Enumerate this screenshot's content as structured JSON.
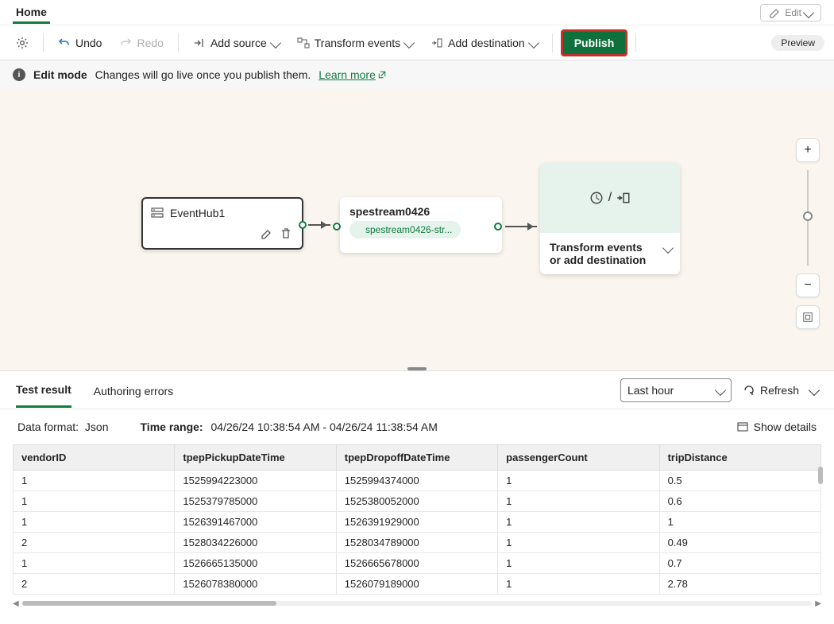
{
  "ribbon": {
    "home": "Home",
    "edit": "Edit"
  },
  "toolbar": {
    "undo": "Undo",
    "redo": "Redo",
    "add_source": "Add source",
    "transform": "Transform events",
    "add_dest": "Add destination",
    "publish": "Publish",
    "preview": "Preview"
  },
  "banner": {
    "mode": "Edit mode",
    "msg": "Changes will go live once you publish them.",
    "learn": "Learn more"
  },
  "canvas": {
    "source_name": "EventHub1",
    "stream_name": "spestream0426",
    "stream_pill": "spestream0426-str...",
    "dest_prompt": "Transform events or add destination"
  },
  "panel": {
    "tab_test": "Test result",
    "tab_errors": "Authoring errors",
    "time_select": "Last hour",
    "refresh": "Refresh"
  },
  "meta": {
    "format_label": "Data format:",
    "format_value": "Json",
    "range_label": "Time range:",
    "range_value": "04/26/24 10:38:54 AM - 04/26/24 11:38:54 AM",
    "show_details": "Show details"
  },
  "table": {
    "headers": [
      "vendorID",
      "tpepPickupDateTime",
      "tpepDropoffDateTime",
      "passengerCount",
      "tripDistance"
    ],
    "rows": [
      [
        "1",
        "1525994223000",
        "1525994374000",
        "1",
        "0.5"
      ],
      [
        "1",
        "1525379785000",
        "1525380052000",
        "1",
        "0.6"
      ],
      [
        "1",
        "1526391467000",
        "1526391929000",
        "1",
        "1"
      ],
      [
        "2",
        "1528034226000",
        "1528034789000",
        "1",
        "0.49"
      ],
      [
        "1",
        "1526665135000",
        "1526665678000",
        "1",
        "0.7"
      ],
      [
        "2",
        "1526078380000",
        "1526079189000",
        "1",
        "2.78"
      ]
    ]
  }
}
